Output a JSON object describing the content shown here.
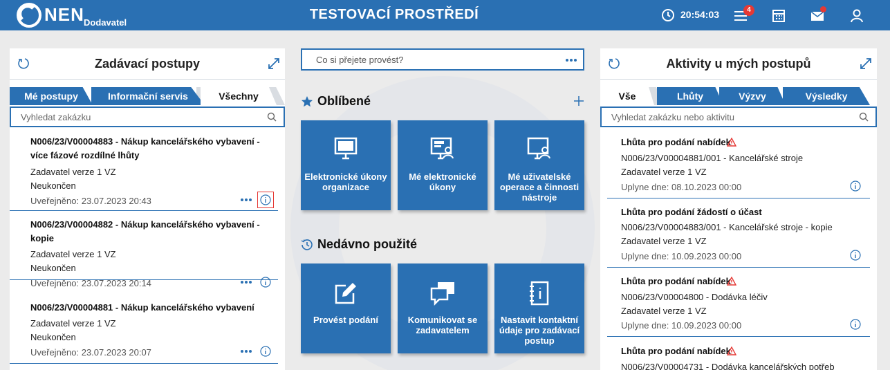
{
  "header": {
    "brand": "NEN",
    "brand_sub": "Dodavatel",
    "env_title": "TESTOVACÍ PROSTŘEDÍ",
    "time": "20:54:03",
    "menu_badge": "4",
    "icons": [
      "clock-icon",
      "menu-icon",
      "calendar-icon",
      "mail-icon",
      "user-icon"
    ]
  },
  "left": {
    "title": "Zadávací postupy",
    "tabs": [
      "Mé postupy",
      "Informační servis",
      "Všechny"
    ],
    "search_placeholder": "Vyhledat zakázku",
    "items": [
      {
        "title": "N006/23/V00004883 - Nákup kancelářského vybavení - více fázové rozdílné lhůty",
        "authority": "Zadavatel verze 1 VZ",
        "status": "Neukončen",
        "published": "Uveřejněno: 23.07.2023 20:43"
      },
      {
        "title": "N006/23/V00004882 - Nákup kancelářského vybavení - kopie",
        "authority": "Zadavatel verze 1 VZ",
        "status": "Neukončen",
        "published": "Uveřejněno: 23.07.2023 20:14"
      },
      {
        "title": "N006/23/V00004881 - Nákup kancelářského vybavení",
        "authority": "Zadavatel verze 1 VZ",
        "status": "Neukončen",
        "published": "Uveřejněno: 23.07.2023 20:07"
      }
    ]
  },
  "middle": {
    "action_placeholder": "Co si přejete provést?",
    "favorites_title": "Oblíbené",
    "favorites": [
      "Elektronické úkony organizace",
      "Mé elektronické úkony",
      "Mé uživatelské operace a činnosti nástroje"
    ],
    "recent_title": "Nedávno použité",
    "recent": [
      "Provést podání",
      "Komunikovat se zadavatelem",
      "Nastavit kontaktní údaje pro zadávací postup"
    ]
  },
  "right": {
    "title": "Aktivity u mých postupů",
    "tabs": [
      "Vše",
      "Lhůty",
      "Výzvy",
      "Výsledky"
    ],
    "search_placeholder": "Vyhledat zakázku nebo aktivitu",
    "items": [
      {
        "title": "Lhůta pro podání nabídek",
        "ref": "N006/23/V00004881/001 - Kancelářské stroje",
        "authority": "Zadavatel verze 1 VZ",
        "due": "Uplyne dne: 08.10.2023 00:00"
      },
      {
        "title": "Lhůta pro podání žádostí o účast",
        "ref": "N006/23/V00004883/001 - Kancelářské stroje - kopie",
        "authority": "Zadavatel verze 1 VZ",
        "due": "Uplyne dne: 10.09.2023 00:00"
      },
      {
        "title": "Lhůta pro podání nabídek",
        "ref": "N006/23/V00004800 - Dodávka léčiv",
        "authority": "Zadavatel verze 1 VZ",
        "due": "Uplyne dne: 10.09.2023 00:00"
      },
      {
        "title": "Lhůta pro podání nabídek",
        "ref": "N006/23/V00004731 - Dodávka kancelářských potřeb"
      }
    ]
  },
  "colors": {
    "brand": "#2a70b3",
    "alert": "#e53935",
    "background": "#ebebeb"
  }
}
